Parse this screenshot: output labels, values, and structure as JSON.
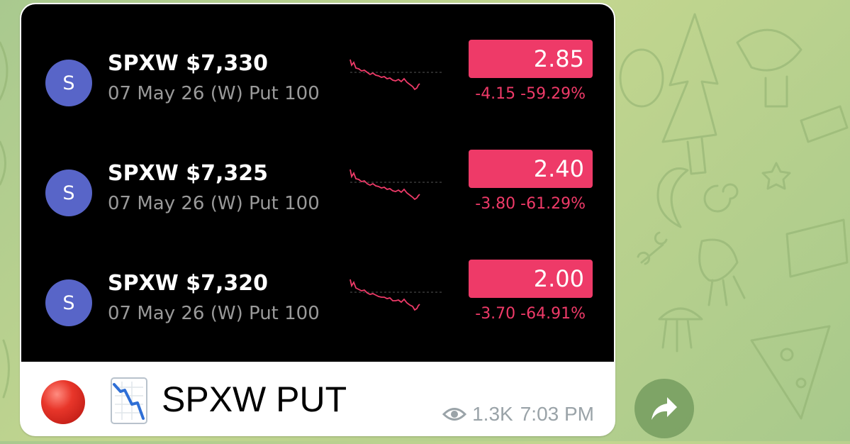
{
  "colors": {
    "avatar": "#5865c8",
    "negative": "#ee3a68",
    "badge_bg": "#ee3a68",
    "card_bg": "#000000"
  },
  "quotes": [
    {
      "avatar_letter": "S",
      "ticker": "SPXW $7,330",
      "contract": "07 May 26 (W) Put 100",
      "price": "2.85",
      "change": "-4.15 -59.29%"
    },
    {
      "avatar_letter": "S",
      "ticker": "SPXW $7,325",
      "contract": "07 May 26 (W) Put 100",
      "price": "2.40",
      "change": "-3.80 -61.29%"
    },
    {
      "avatar_letter": "S",
      "ticker": "SPXW $7,320",
      "contract": "07 May 26 (W) Put 100",
      "price": "2.00",
      "change": "-3.70 -64.91%"
    }
  ],
  "message": {
    "status_emoji": "red-circle-emoji",
    "chart_emoji": "chart-decreasing-emoji",
    "text": "SPXW PUT",
    "views": "1.3K",
    "time": "7:03 PM"
  },
  "icons": {
    "views": "eye-icon",
    "share": "share-arrow-icon"
  }
}
